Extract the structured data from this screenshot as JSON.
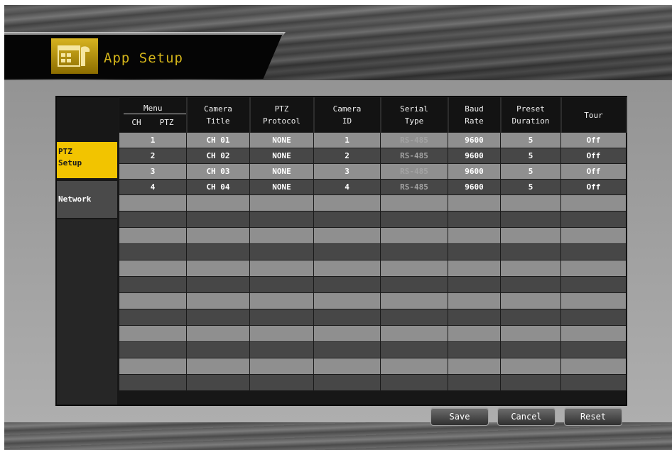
{
  "header": {
    "app_title": "App Setup"
  },
  "sidebar": {
    "tabs": [
      {
        "label": "PTZ\nSetup",
        "selected": true
      },
      {
        "label": "Network",
        "selected": false
      }
    ]
  },
  "table": {
    "menu_header": "Menu",
    "menu_sub": [
      "CH",
      "PTZ"
    ],
    "columns": [
      "Camera\nTitle",
      "PTZ\nProtocol",
      "Camera\nID",
      "Serial\nType",
      "Baud\nRate",
      "Preset\nDuration",
      "Tour"
    ],
    "rows": [
      {
        "ch": "1",
        "title": "CH 01",
        "protocol": "NONE",
        "id": "1",
        "serial": "RS-485",
        "baud": "9600",
        "duration": "5",
        "tour": "Off"
      },
      {
        "ch": "2",
        "title": "CH 02",
        "protocol": "NONE",
        "id": "2",
        "serial": "RS-485",
        "baud": "9600",
        "duration": "5",
        "tour": "Off"
      },
      {
        "ch": "3",
        "title": "CH 03",
        "protocol": "NONE",
        "id": "3",
        "serial": "RS-485",
        "baud": "9600",
        "duration": "5",
        "tour": "Off"
      },
      {
        "ch": "4",
        "title": "CH 04",
        "protocol": "NONE",
        "id": "4",
        "serial": "RS-485",
        "baud": "9600",
        "duration": "5",
        "tour": "Off"
      }
    ]
  },
  "buttons": {
    "save": "Save",
    "cancel": "Cancel",
    "reset": "Reset"
  },
  "colors": {
    "accent": "#f2c400",
    "title_text": "#d4b51a",
    "panel_bg": "#171717"
  }
}
